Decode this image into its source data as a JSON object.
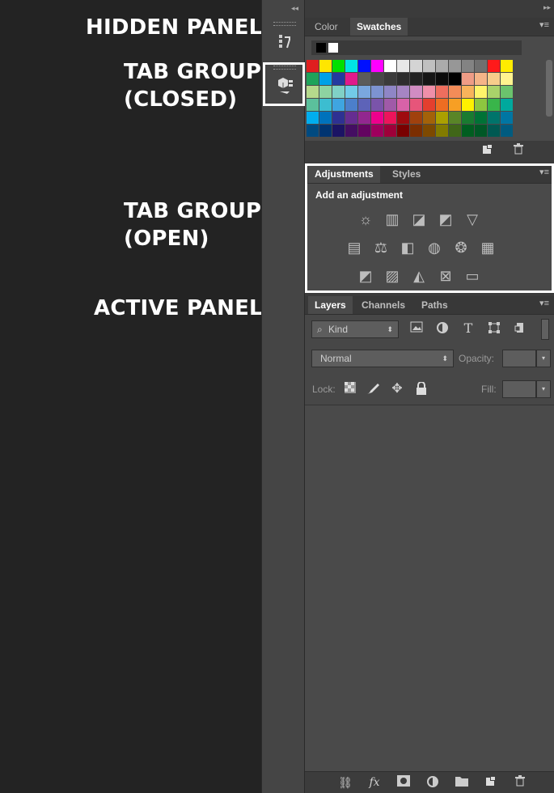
{
  "callouts": {
    "hidden_panel": "HIDDEN PANEL",
    "tab_group_closed_1": "TAB GROUP",
    "tab_group_closed_2": "(CLOSED)",
    "tab_group_open_1": "TAB GROUP",
    "tab_group_open_2": "(OPEN)",
    "active_panel": "ACTIVE PANEL"
  },
  "dock": {
    "collapse_glyph": "◂◂",
    "expand_glyph": "▸▸",
    "history_icon": "history-icon",
    "properties_icon": "properties-icon"
  },
  "swatches_panel": {
    "tabs": [
      "Color",
      "Swatches"
    ],
    "active_tab": "Swatches",
    "footer_icons": [
      "new-swatch-icon",
      "trash-icon"
    ],
    "rows": [
      [
        "#e01f1f",
        "#ffe600",
        "#00e000",
        "#00e5e5",
        "#0010ff",
        "#ff00ff",
        "#ffffff",
        "#e8e8e8",
        "#d4d4d4",
        "#c0c0c0",
        "#ababab",
        "#979797",
        "#838383",
        "#6f6f6f",
        "#ff1a1a",
        "#ffec00"
      ],
      [
        "#1ea35a",
        "#00a0e6",
        "#233aa0",
        "#e0198c",
        "#5b5b5b",
        "#484848",
        "#3b3b3b",
        "#2d2d2d",
        "#222222",
        "#151515",
        "#0b0b0b",
        "#000000",
        "#ef9c86",
        "#f5b488",
        "#f7cd8b",
        "#fff38f"
      ],
      [
        "#b5d98c",
        "#8ed3a1",
        "#80d1c6",
        "#72cbe8",
        "#7aa7df",
        "#7d93d1",
        "#8f86c6",
        "#a685c3",
        "#d18cc2",
        "#ef8fa9",
        "#ee6e5e",
        "#f38c58",
        "#f8b35b",
        "#fff46a",
        "#a9d36a",
        "#6bc36d"
      ],
      [
        "#5bc09c",
        "#3cbdd0",
        "#3fa5e0",
        "#4c7fcb",
        "#5d63b8",
        "#7a54aa",
        "#a05aa8",
        "#d862a8",
        "#e7557a",
        "#e43f2e",
        "#ee6d22",
        "#f79f24",
        "#fff100",
        "#8dc63f",
        "#39b54a",
        "#00a99d"
      ],
      [
        "#00aeef",
        "#0072bc",
        "#2e3192",
        "#662d91",
        "#92278f",
        "#ec008c",
        "#ed145b",
        "#9e0b0f",
        "#a0410d",
        "#a36209",
        "#aba000",
        "#598527",
        "#197b30",
        "#007236",
        "#00746b",
        "#0076a3"
      ],
      [
        "#004a80",
        "#003471",
        "#1b1464",
        "#440e62",
        "#630460",
        "#9e005d",
        "#9e0039",
        "#790000",
        "#7b2e00",
        "#7d4900",
        "#827b00",
        "#406618",
        "#005e20",
        "#005826",
        "#005952",
        "#005b7f"
      ]
    ]
  },
  "adjustments_panel": {
    "tabs": [
      "Adjustments",
      "Styles"
    ],
    "active_tab": "Adjustments",
    "heading": "Add an adjustment",
    "row1": [
      "brightness-contrast-icon",
      "levels-icon",
      "curves-icon",
      "exposure-icon",
      "vibrance-icon"
    ],
    "row2": [
      "hue-saturation-icon",
      "color-balance-icon",
      "black-white-icon",
      "photo-filter-icon",
      "channel-mixer-icon",
      "color-lookup-icon"
    ],
    "row3": [
      "invert-icon",
      "posterize-icon",
      "threshold-icon",
      "selective-color-icon",
      "gradient-map-icon"
    ]
  },
  "layers_panel": {
    "tabs": [
      "Layers",
      "Channels",
      "Paths"
    ],
    "active_tab": "Layers",
    "filter_kind": "Kind",
    "blend_mode": "Normal",
    "opacity_label": "Opacity:",
    "lock_label": "Lock:",
    "fill_label": "Fill:",
    "footer_icons": [
      "link-icon",
      "fx-icon",
      "mask-icon",
      "adjustment-layer-icon",
      "group-folder-icon",
      "new-layer-icon",
      "trash-icon"
    ],
    "fx_text": "fx"
  }
}
